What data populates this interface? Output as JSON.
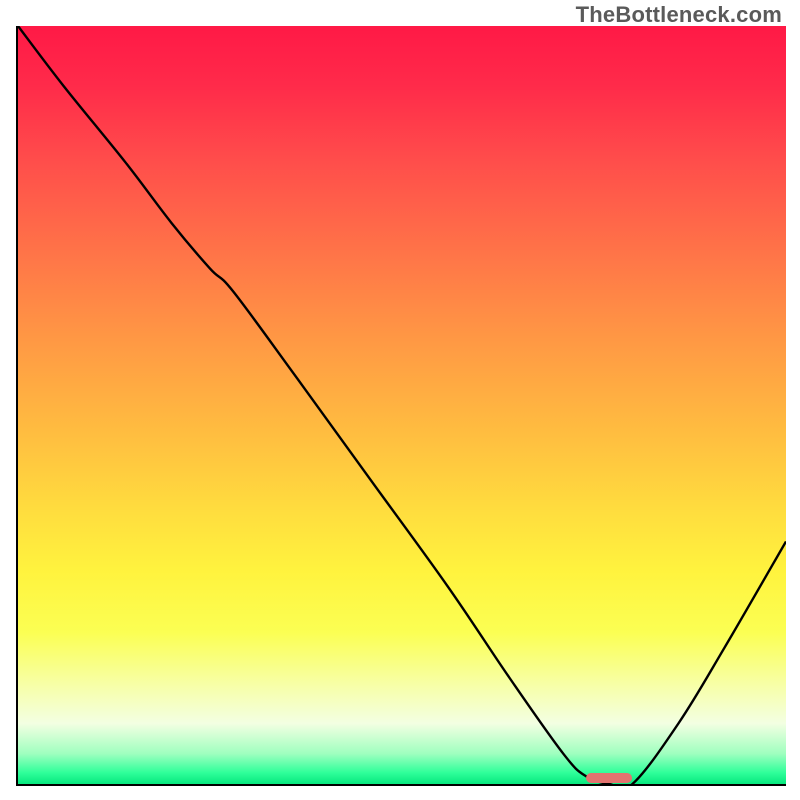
{
  "watermark": "TheBottleneck.com",
  "colors": {
    "curve": "#000000",
    "marker": "#e2736f",
    "axis": "#000000"
  },
  "chart_data": {
    "type": "line",
    "title": "",
    "xlabel": "",
    "ylabel": "",
    "xlim": [
      0,
      100
    ],
    "ylim": [
      0,
      100
    ],
    "series": [
      {
        "name": "bottleneck-curve",
        "x": [
          0,
          6,
          14,
          20,
          25,
          28,
          36,
          46,
          56,
          64,
          71,
          74,
          77,
          80,
          86,
          92,
          100
        ],
        "y": [
          100,
          92,
          82,
          74,
          68,
          65,
          54,
          40,
          26,
          14,
          4,
          1,
          0,
          0,
          8,
          18,
          32
        ]
      }
    ],
    "marker": {
      "x_start": 74,
      "x_end": 80,
      "y": 0
    },
    "gradient_stops": [
      {
        "pct": 0,
        "color": "#ff1946"
      },
      {
        "pct": 50,
        "color": "#ffbe40"
      },
      {
        "pct": 80,
        "color": "#fbff53"
      },
      {
        "pct": 100,
        "color": "#07e87e"
      }
    ]
  }
}
